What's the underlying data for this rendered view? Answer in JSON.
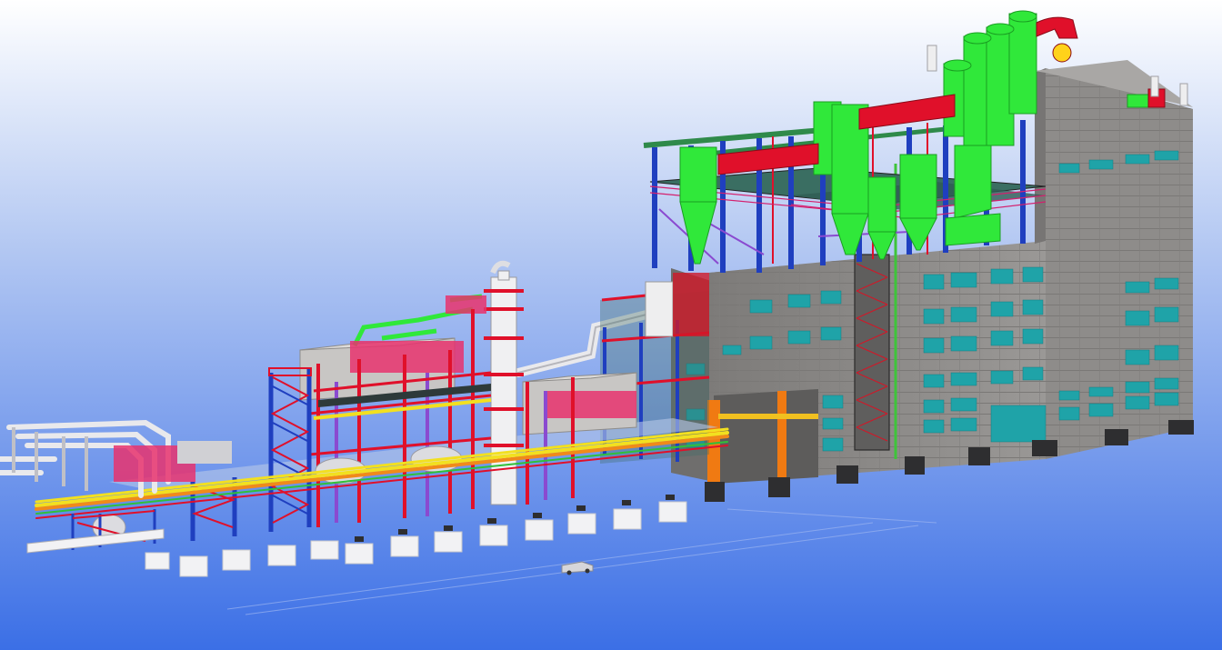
{
  "scene": {
    "background_top": "#ffffff",
    "background_bottom": "#3b6fe6",
    "colors": {
      "building_wall": "#8f8d8b",
      "building_dark": "#6f6e6d",
      "window": "#1fa3a8",
      "steel_blue": "#1f3fbf",
      "steel_red": "#e0102a",
      "magenta": "#d4206e",
      "equipment_green": "#30e83a",
      "pipe_yellow": "#f2e020",
      "pipe_orange": "#f08a1a",
      "concrete": "#f2f2f4",
      "pipe_white": "#e9e9ec",
      "purple": "#8a4ad0"
    }
  }
}
